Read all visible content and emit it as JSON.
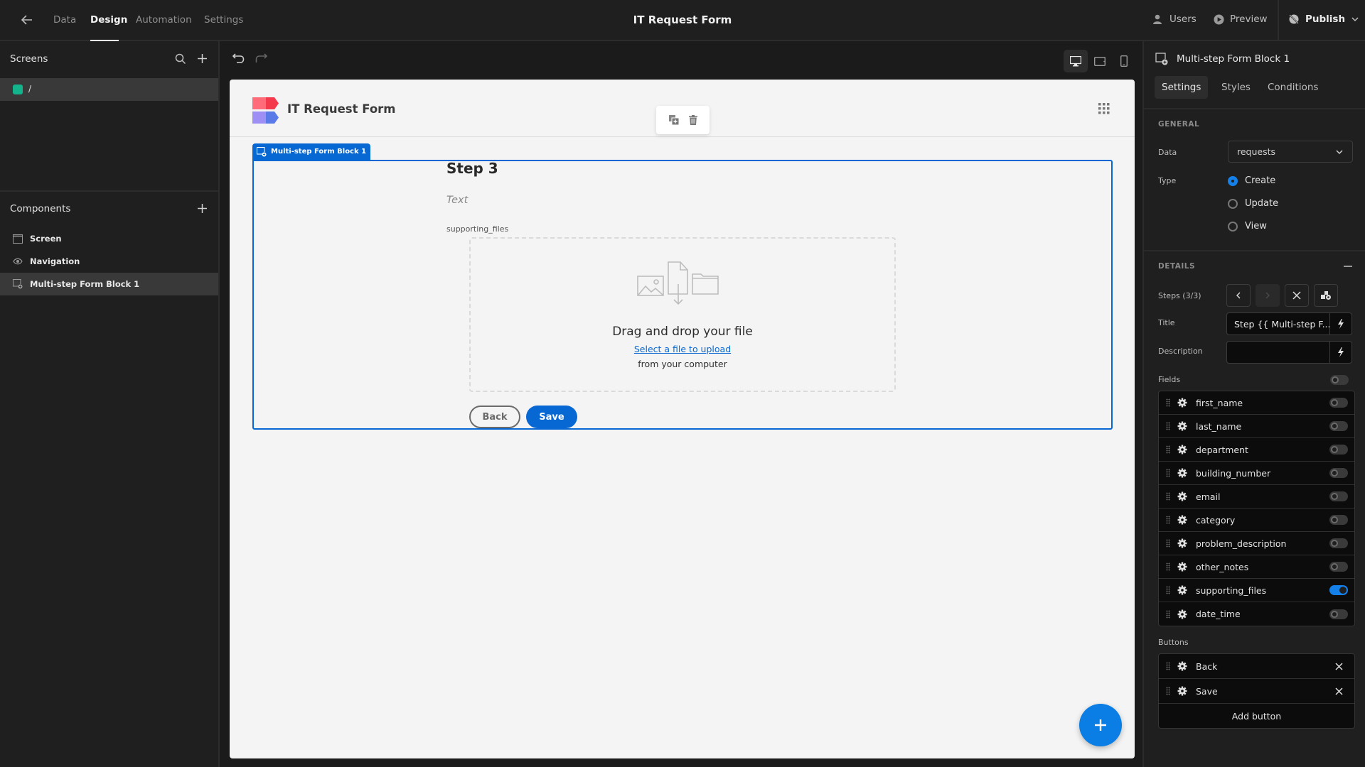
{
  "topbar": {
    "tabs": [
      {
        "label": "Data",
        "active": false
      },
      {
        "label": "Design",
        "active": true
      },
      {
        "label": "Automation",
        "active": false
      },
      {
        "label": "Settings",
        "active": false
      }
    ],
    "app_title": "IT Request Form",
    "users_label": "Users",
    "preview_label": "Preview",
    "publish_label": "Publish"
  },
  "sidebar": {
    "screens_title": "Screens",
    "screens": [
      {
        "route": "/",
        "color": "#13b38c",
        "selected": true
      }
    ],
    "components_title": "Components",
    "components": [
      {
        "label": "Screen",
        "icon": "screen-icon",
        "selected": false
      },
      {
        "label": "Navigation",
        "icon": "eye-icon",
        "selected": false
      },
      {
        "label": "Multi-step Form Block 1",
        "icon": "form-block-icon",
        "selected": true
      }
    ]
  },
  "canvas": {
    "app_name": "IT Request Form",
    "block_tab_label": "Multi-step Form Block 1",
    "step_title": "Step 3",
    "step_description": "Text",
    "field_label": "supporting_files",
    "dropzone": {
      "title": "Drag and drop your file",
      "link": "Select a file to upload",
      "subtitle": "from your computer"
    },
    "back_label": "Back",
    "save_label": "Save",
    "accent": "#0868d3"
  },
  "rpanel": {
    "title": "Multi-step Form Block 1",
    "tabs": [
      {
        "label": "Settings",
        "active": true
      },
      {
        "label": "Styles",
        "active": false
      },
      {
        "label": "Conditions",
        "active": false
      }
    ],
    "general": {
      "section": "GENERAL",
      "data_label": "Data",
      "data_value": "requests",
      "type_label": "Type",
      "types": [
        {
          "label": "Create",
          "selected": true
        },
        {
          "label": "Update",
          "selected": false
        },
        {
          "label": "View",
          "selected": false
        }
      ]
    },
    "details": {
      "section": "DETAILS",
      "steps_label": "Steps (3/3)",
      "title_label": "Title",
      "title_value": "Step {{ Multi-step F...",
      "description_label": "Description",
      "description_value": "",
      "fields_label": "Fields",
      "fields_toggle": false,
      "fields": [
        {
          "name": "first_name",
          "enabled": false
        },
        {
          "name": "last_name",
          "enabled": false
        },
        {
          "name": "department",
          "enabled": false
        },
        {
          "name": "building_number",
          "enabled": false
        },
        {
          "name": "email",
          "enabled": false
        },
        {
          "name": "category",
          "enabled": false
        },
        {
          "name": "problem_description",
          "enabled": false
        },
        {
          "name": "other_notes",
          "enabled": false
        },
        {
          "name": "supporting_files",
          "enabled": true
        },
        {
          "name": "date_time",
          "enabled": false
        }
      ],
      "buttons_label": "Buttons",
      "buttons": [
        {
          "name": "Back"
        },
        {
          "name": "Save"
        }
      ],
      "add_button_label": "Add button"
    }
  }
}
